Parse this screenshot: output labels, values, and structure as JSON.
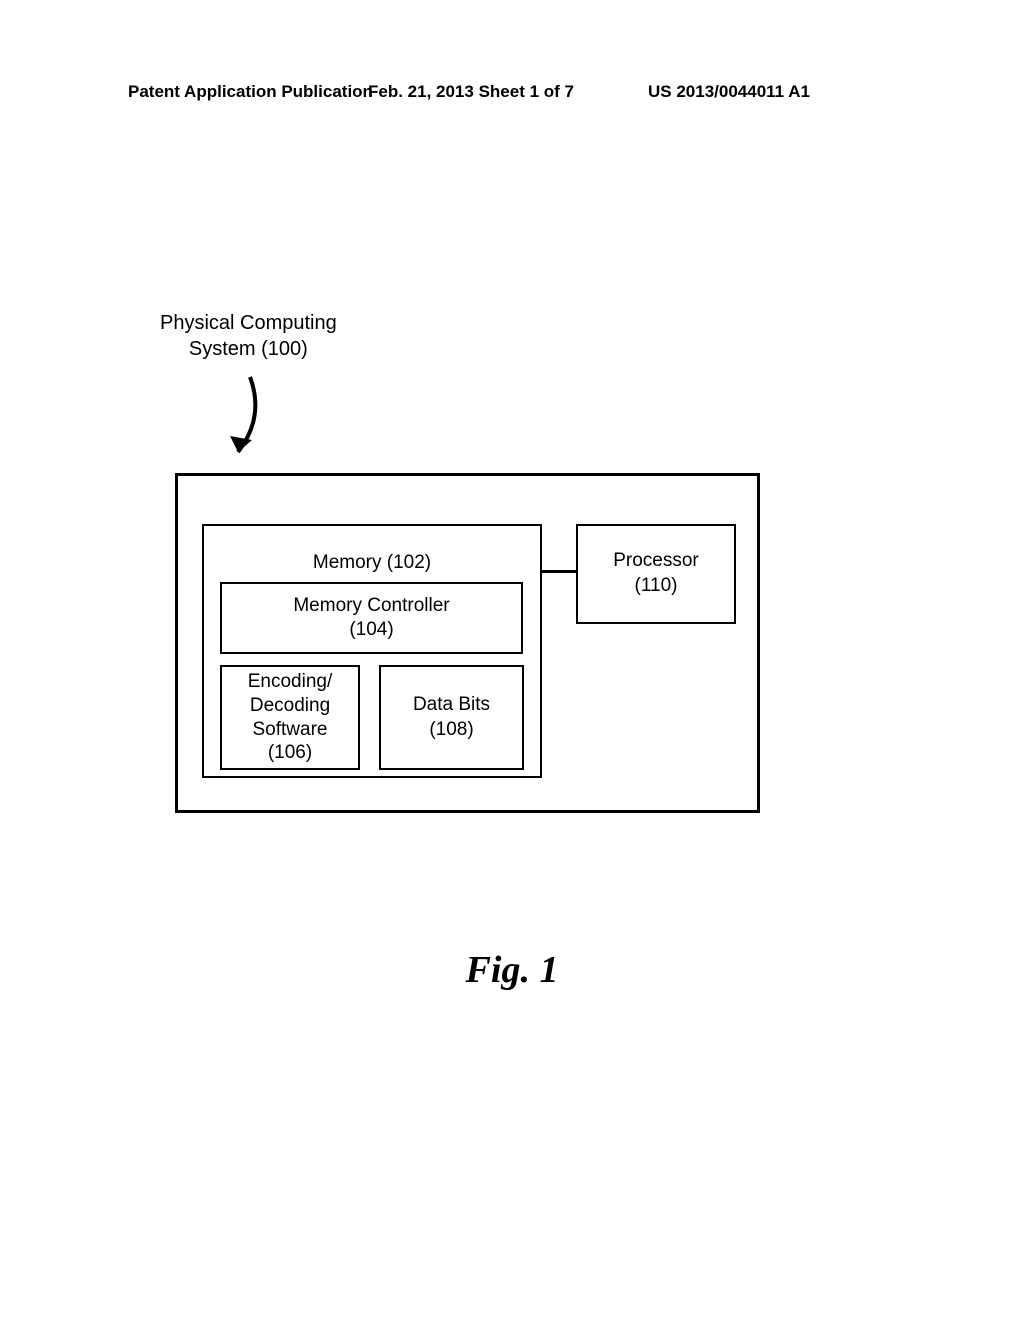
{
  "header": {
    "left": "Patent Application Publication",
    "center": "Feb. 21, 2013  Sheet 1 of 7",
    "right": "US 2013/0044011 A1"
  },
  "system_label_line1": "Physical Computing",
  "system_label_line2": "System (100)",
  "memory_title": "Memory (102)",
  "memcont_line1": "Memory Controller",
  "memcont_line2": "(104)",
  "enc_line1": "Encoding/",
  "enc_line2": "Decoding",
  "enc_line3": "Software",
  "enc_line4": "(106)",
  "data_line1": "Data Bits",
  "data_line2": "(108)",
  "proc_line1": "Processor",
  "proc_line2": "(110)",
  "figure_label": "Fig. 1"
}
